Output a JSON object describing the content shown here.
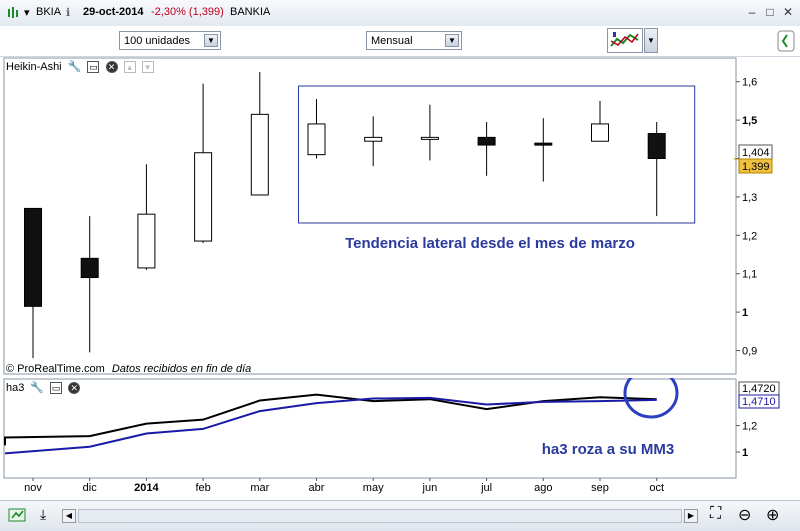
{
  "window": {
    "symbol": "BKIA",
    "info_icon": "info-icon",
    "date": "29-oct-2014",
    "change": "-2,30% (1,399)",
    "name": "BANKIA",
    "change_color": "#c0001a"
  },
  "toolbar": {
    "units_select": "100 unidades",
    "period_select": "Mensual"
  },
  "main_panel": {
    "indicator_label": "Heikin-Ashi",
    "copyright": "© ProRealTime.com",
    "data_note": "Datos recibidos en fin de día",
    "annotation": "Tendencia lateral desde el mes de marzo",
    "annotation_color": "#2b3a9e",
    "price_tags": [
      "1,404",
      "1,399"
    ]
  },
  "sub_panel": {
    "indicator_label": "ha3",
    "annotation": "ha3 roza a su MM3",
    "value_tags": [
      "1,4720",
      "1,4710"
    ]
  },
  "chart_data": [
    {
      "type": "candlestick",
      "title": "",
      "categories": [
        "nov",
        "dic",
        "2014",
        "feb",
        "mar",
        "abr",
        "may",
        "jun",
        "jul",
        "ago",
        "sep",
        "oct"
      ],
      "candles": [
        {
          "open": 1.27,
          "close": 1.015,
          "high": 1.27,
          "low": 0.88,
          "color": "black"
        },
        {
          "open": 1.14,
          "close": 1.09,
          "high": 1.25,
          "low": 0.895,
          "color": "black"
        },
        {
          "open": 1.115,
          "close": 1.255,
          "high": 1.385,
          "low": 1.11,
          "color": "white"
        },
        {
          "open": 1.185,
          "close": 1.415,
          "high": 1.595,
          "low": 1.18,
          "color": "white"
        },
        {
          "open": 1.305,
          "close": 1.515,
          "high": 1.625,
          "low": 1.305,
          "color": "white"
        },
        {
          "open": 1.41,
          "close": 1.49,
          "high": 1.555,
          "low": 1.4,
          "color": "white"
        },
        {
          "open": 1.445,
          "close": 1.455,
          "high": 1.51,
          "low": 1.38,
          "color": "white"
        },
        {
          "open": 1.45,
          "close": 1.455,
          "high": 1.54,
          "low": 1.395,
          "color": "white"
        },
        {
          "open": 1.455,
          "close": 1.435,
          "high": 1.495,
          "low": 1.355,
          "color": "black"
        },
        {
          "open": 1.44,
          "close": 1.44,
          "high": 1.505,
          "low": 1.34,
          "color": "black"
        },
        {
          "open": 1.445,
          "close": 1.49,
          "high": 1.55,
          "low": 1.445,
          "color": "white"
        },
        {
          "open": 1.465,
          "close": 1.4,
          "high": 1.495,
          "low": 1.25,
          "color": "black"
        }
      ],
      "y_ticks": [
        "0,9",
        "1",
        "1,1",
        "1,2",
        "1,3",
        "1,4",
        "1,5",
        "1,6"
      ],
      "y_tick_values": [
        0.9,
        1.0,
        1.1,
        1.2,
        1.3,
        1.4,
        1.5,
        1.6
      ],
      "ylim": [
        0.86,
        1.66
      ],
      "last_price": 1.399,
      "highlight_range": [
        "abr",
        "oct"
      ]
    },
    {
      "type": "line",
      "title": "",
      "categories": [
        "nov",
        "dic",
        "2014",
        "feb",
        "mar",
        "abr",
        "may",
        "jun",
        "jul",
        "ago",
        "sep",
        "oct"
      ],
      "series": [
        {
          "color": "#000000",
          "values": [
            1.11,
            1.12,
            1.215,
            1.245,
            1.39,
            1.435,
            1.385,
            1.4,
            1.325,
            1.385,
            1.415,
            1.4
          ]
        },
        {
          "color": "#1a1aa6",
          "values": [
            0.99,
            1.04,
            1.14,
            1.175,
            1.31,
            1.37,
            1.405,
            1.41,
            1.36,
            1.38,
            1.385,
            1.395
          ]
        }
      ],
      "y_ticks": [
        "1",
        "1,2"
      ],
      "y_tick_values": [
        1.0,
        1.2
      ],
      "ylim": [
        0.93,
        1.5
      ],
      "x_labels": [
        "nov",
        "dic",
        "2014",
        "feb",
        "mar",
        "abr",
        "may",
        "jun",
        "jul",
        "ago",
        "sep",
        "oct"
      ],
      "x_bold": "2014"
    }
  ]
}
